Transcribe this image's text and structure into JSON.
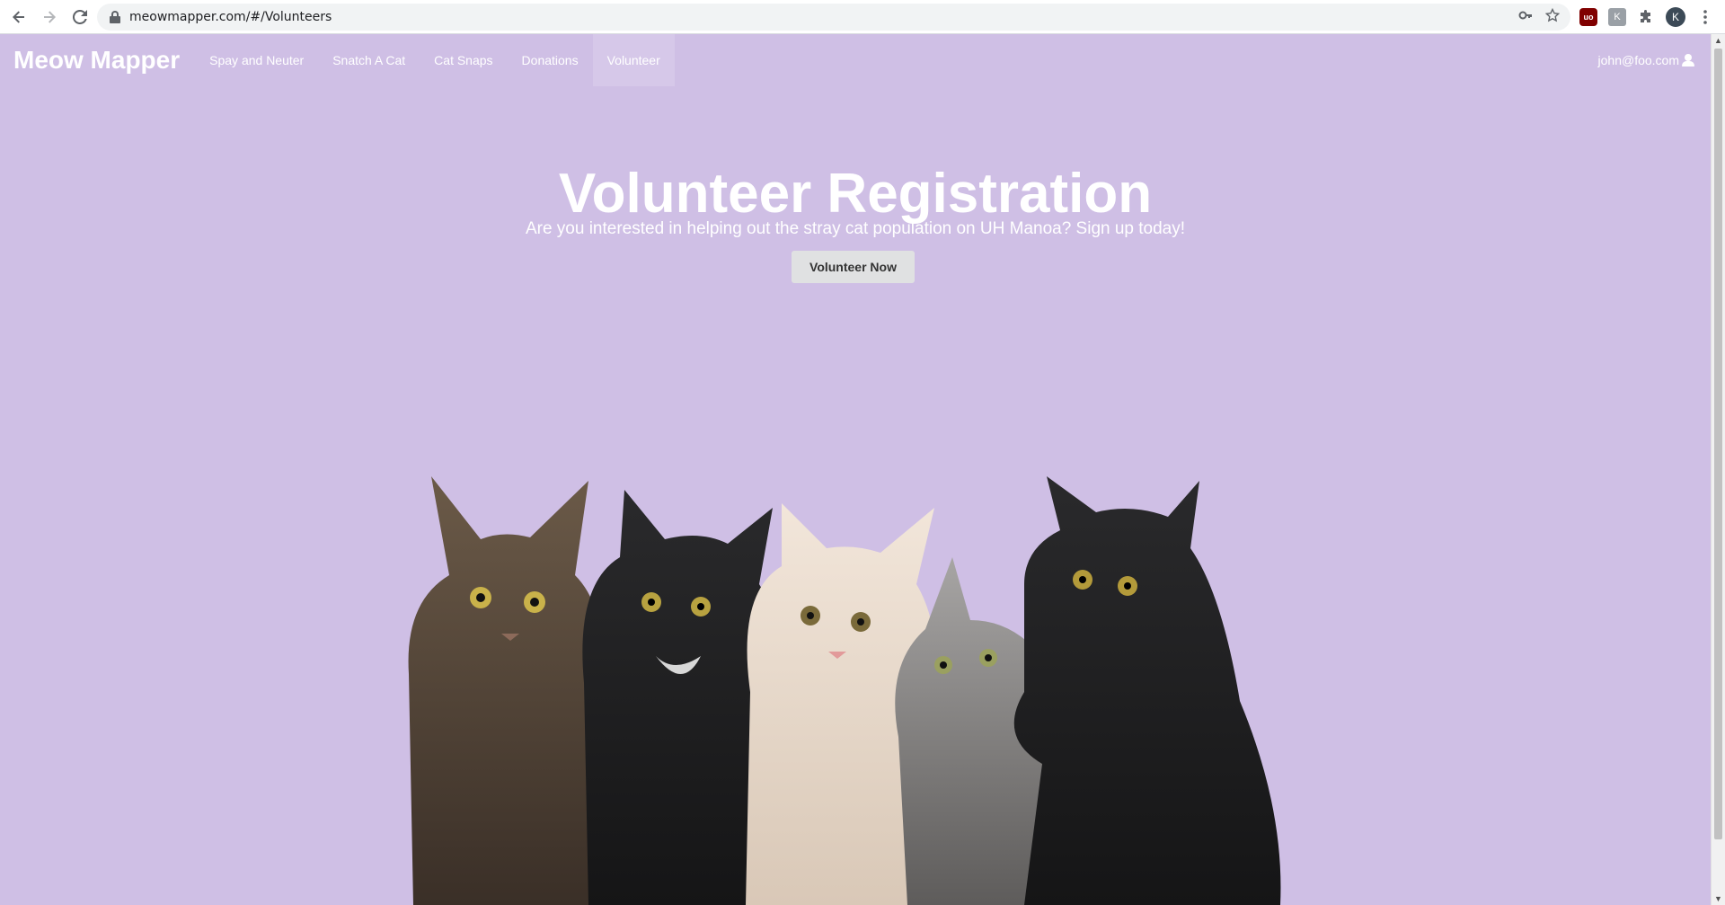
{
  "browser": {
    "url": "meowmapper.com/#/Volunteers",
    "profile_initial": "K",
    "ublock_label": "uo",
    "ext_label": "K"
  },
  "navbar": {
    "brand": "Meow Mapper",
    "links": [
      {
        "label": "Spay and Neuter"
      },
      {
        "label": "Snatch A Cat"
      },
      {
        "label": "Cat Snaps"
      },
      {
        "label": "Donations"
      },
      {
        "label": "Volunteer"
      }
    ],
    "active_link": "Volunteer",
    "user_email": "john@foo.com"
  },
  "hero": {
    "title": "Volunteer Registration",
    "subtitle": "Are you interested in helping out the stray cat population on UH Manoa? Sign up today!",
    "cta_label": "Volunteer Now"
  },
  "colors": {
    "page_background": "#cfbfe5",
    "text": "#ffffff",
    "button": "#e0e1e2"
  }
}
